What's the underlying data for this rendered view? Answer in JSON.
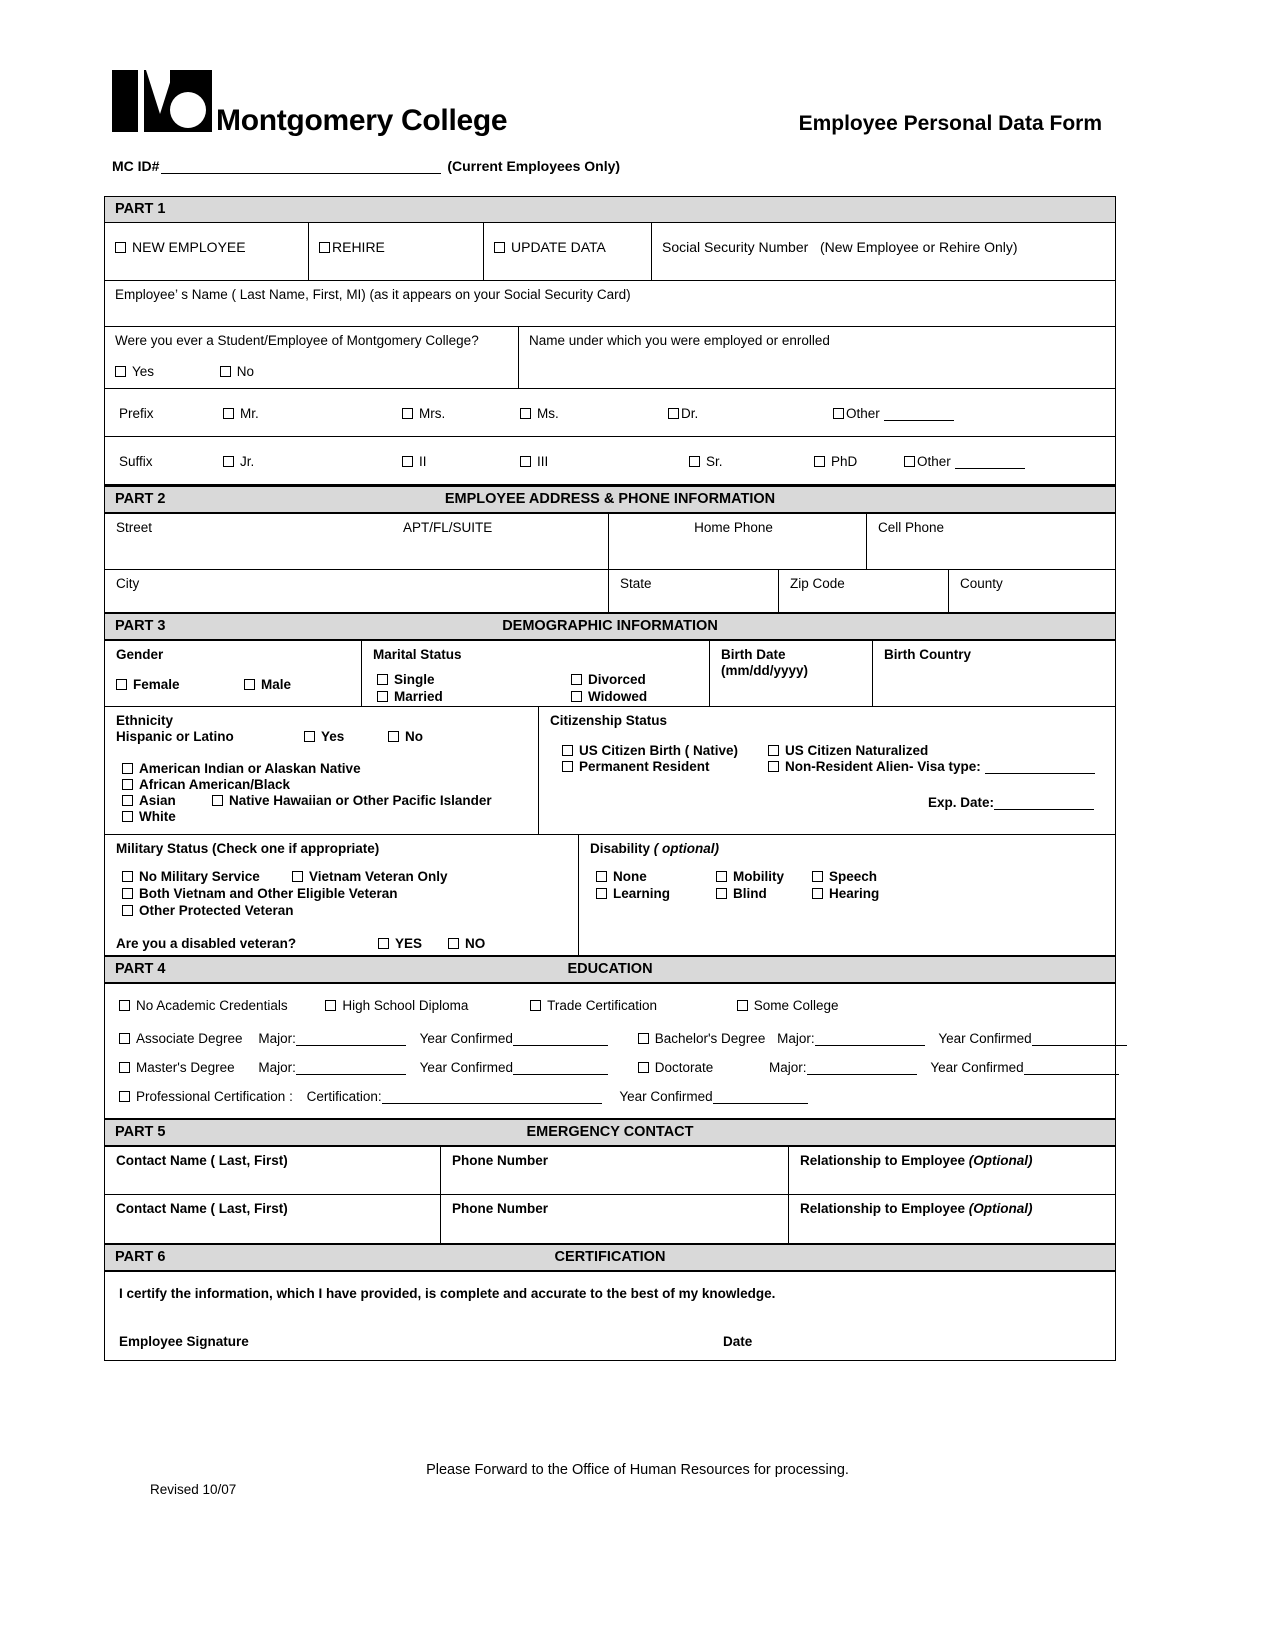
{
  "header": {
    "brand": "Montgomery College",
    "form_title": "Employee Personal Data Form",
    "mc_id_label": "MC ID#",
    "mc_id_note": "(Current Employees Only)"
  },
  "part1": {
    "bar_num": "PART 1",
    "bar_title": "",
    "status_options": [
      "NEW EMPLOYEE",
      "REHIRE",
      "UPDATE DATA"
    ],
    "ssn_label": "Social Security Number",
    "ssn_note": "(New Employee or Rehire Only)",
    "name_label": "Employee’ s Name ( Last Name, First, MI)  (as it appears on your Social Security Card)",
    "student_question": "Were you ever a Student/Employee of Montgomery College?",
    "yes": "Yes",
    "no": "No",
    "prior_name_label": "Name under which you were employed or enrolled",
    "prefix_label": "Prefix",
    "prefix_options": [
      "Mr.",
      "Mrs.",
      "Ms.",
      "Dr."
    ],
    "prefix_other": "Other",
    "suffix_label": "Suffix",
    "suffix_options": [
      "Jr.",
      "II",
      "III",
      "Sr.",
      "PhD"
    ],
    "suffix_other": "Other"
  },
  "part2": {
    "bar_num": "PART 2",
    "bar_title": "EMPLOYEE ADDRESS & PHONE INFORMATION",
    "street": "Street",
    "apt": "APT/FL/SUITE",
    "home_phone": "Home Phone",
    "cell_phone": "Cell Phone",
    "city": "City",
    "state": "State",
    "zip": "Zip Code",
    "county": "County"
  },
  "part3": {
    "bar_num": "PART 3",
    "bar_title": "DEMOGRAPHIC INFORMATION",
    "gender_label": "Gender",
    "gender_options": [
      "Female",
      "Male"
    ],
    "marital_label": "Marital Status",
    "marital_options": [
      "Single",
      "Married",
      "Divorced",
      "Widowed"
    ],
    "birth_date_label": "Birth Date",
    "birth_date_format": "(mm/dd/yyyy)",
    "birth_country_label": "Birth Country",
    "ethnicity_label": "Ethnicity",
    "hispanic_label": "Hispanic or Latino",
    "hispanic_yes": "Yes",
    "hispanic_no": "No",
    "race_options": [
      "American Indian or Alaskan Native",
      "African American/Black",
      "Asian",
      "Native Hawaiian or Other Pacific Islander",
      "White"
    ],
    "citizenship_label": "Citizenship Status",
    "citizenship_options": [
      "US Citizen Birth ( Native)",
      "US Citizen Naturalized",
      "Permanent Resident",
      "Non-Resident Alien- Visa type:"
    ],
    "exp_date_label": "Exp. Date:",
    "military_label": "Military Status (Check one if appropriate)",
    "military_options": [
      "No Military Service",
      "Vietnam Veteran Only",
      "Both Vietnam and Other Eligible Veteran",
      "Other Protected Veteran"
    ],
    "disabled_vet_question": "Are you a disabled veteran?",
    "disabled_vet_yes": "YES",
    "disabled_vet_no": "NO",
    "disability_label": "Disability",
    "disability_optional": "( optional)",
    "disability_options": [
      "None",
      "Mobility",
      "Speech",
      "Learning",
      "Blind",
      "Hearing"
    ]
  },
  "part4": {
    "bar_num": "PART 4",
    "bar_title": "EDUCATION",
    "basic_options": [
      "No Academic Credentials",
      "High School Diploma",
      "Trade Certification",
      "Some College"
    ],
    "degrees": [
      {
        "name": "Associate Degree",
        "major_label": "Major:",
        "year_label": "Year Confirmed"
      },
      {
        "name": "Bachelor's Degree",
        "major_label": "Major:",
        "year_label": "Year Confirmed"
      },
      {
        "name": "Master's Degree",
        "major_label": "Major:",
        "year_label": "Year Confirmed"
      },
      {
        "name": "Doctorate",
        "major_label": "Major:",
        "year_label": "Year Confirmed"
      }
    ],
    "prof_cert": "Professional Certification :",
    "prof_cert_field": "Certification:",
    "prof_cert_year": "Year Confirmed"
  },
  "part5": {
    "bar_num": "PART 5",
    "bar_title": "EMERGENCY CONTACT",
    "contact_name": "Contact Name ( Last, First)",
    "phone_number": "Phone Number",
    "relationship": "Relationship to Employee",
    "relationship_optional": "(Optional)"
  },
  "part6": {
    "bar_num": "PART 6",
    "bar_title": "CERTIFICATION",
    "certify_text": "I certify the information, which I have provided, is complete and accurate to the best of my knowledge.",
    "signature_label": "Employee Signature",
    "date_label": "Date"
  },
  "footer": {
    "note": "Please Forward to the Office of Human Resources for processing.",
    "revised": "Revised 10/07"
  }
}
